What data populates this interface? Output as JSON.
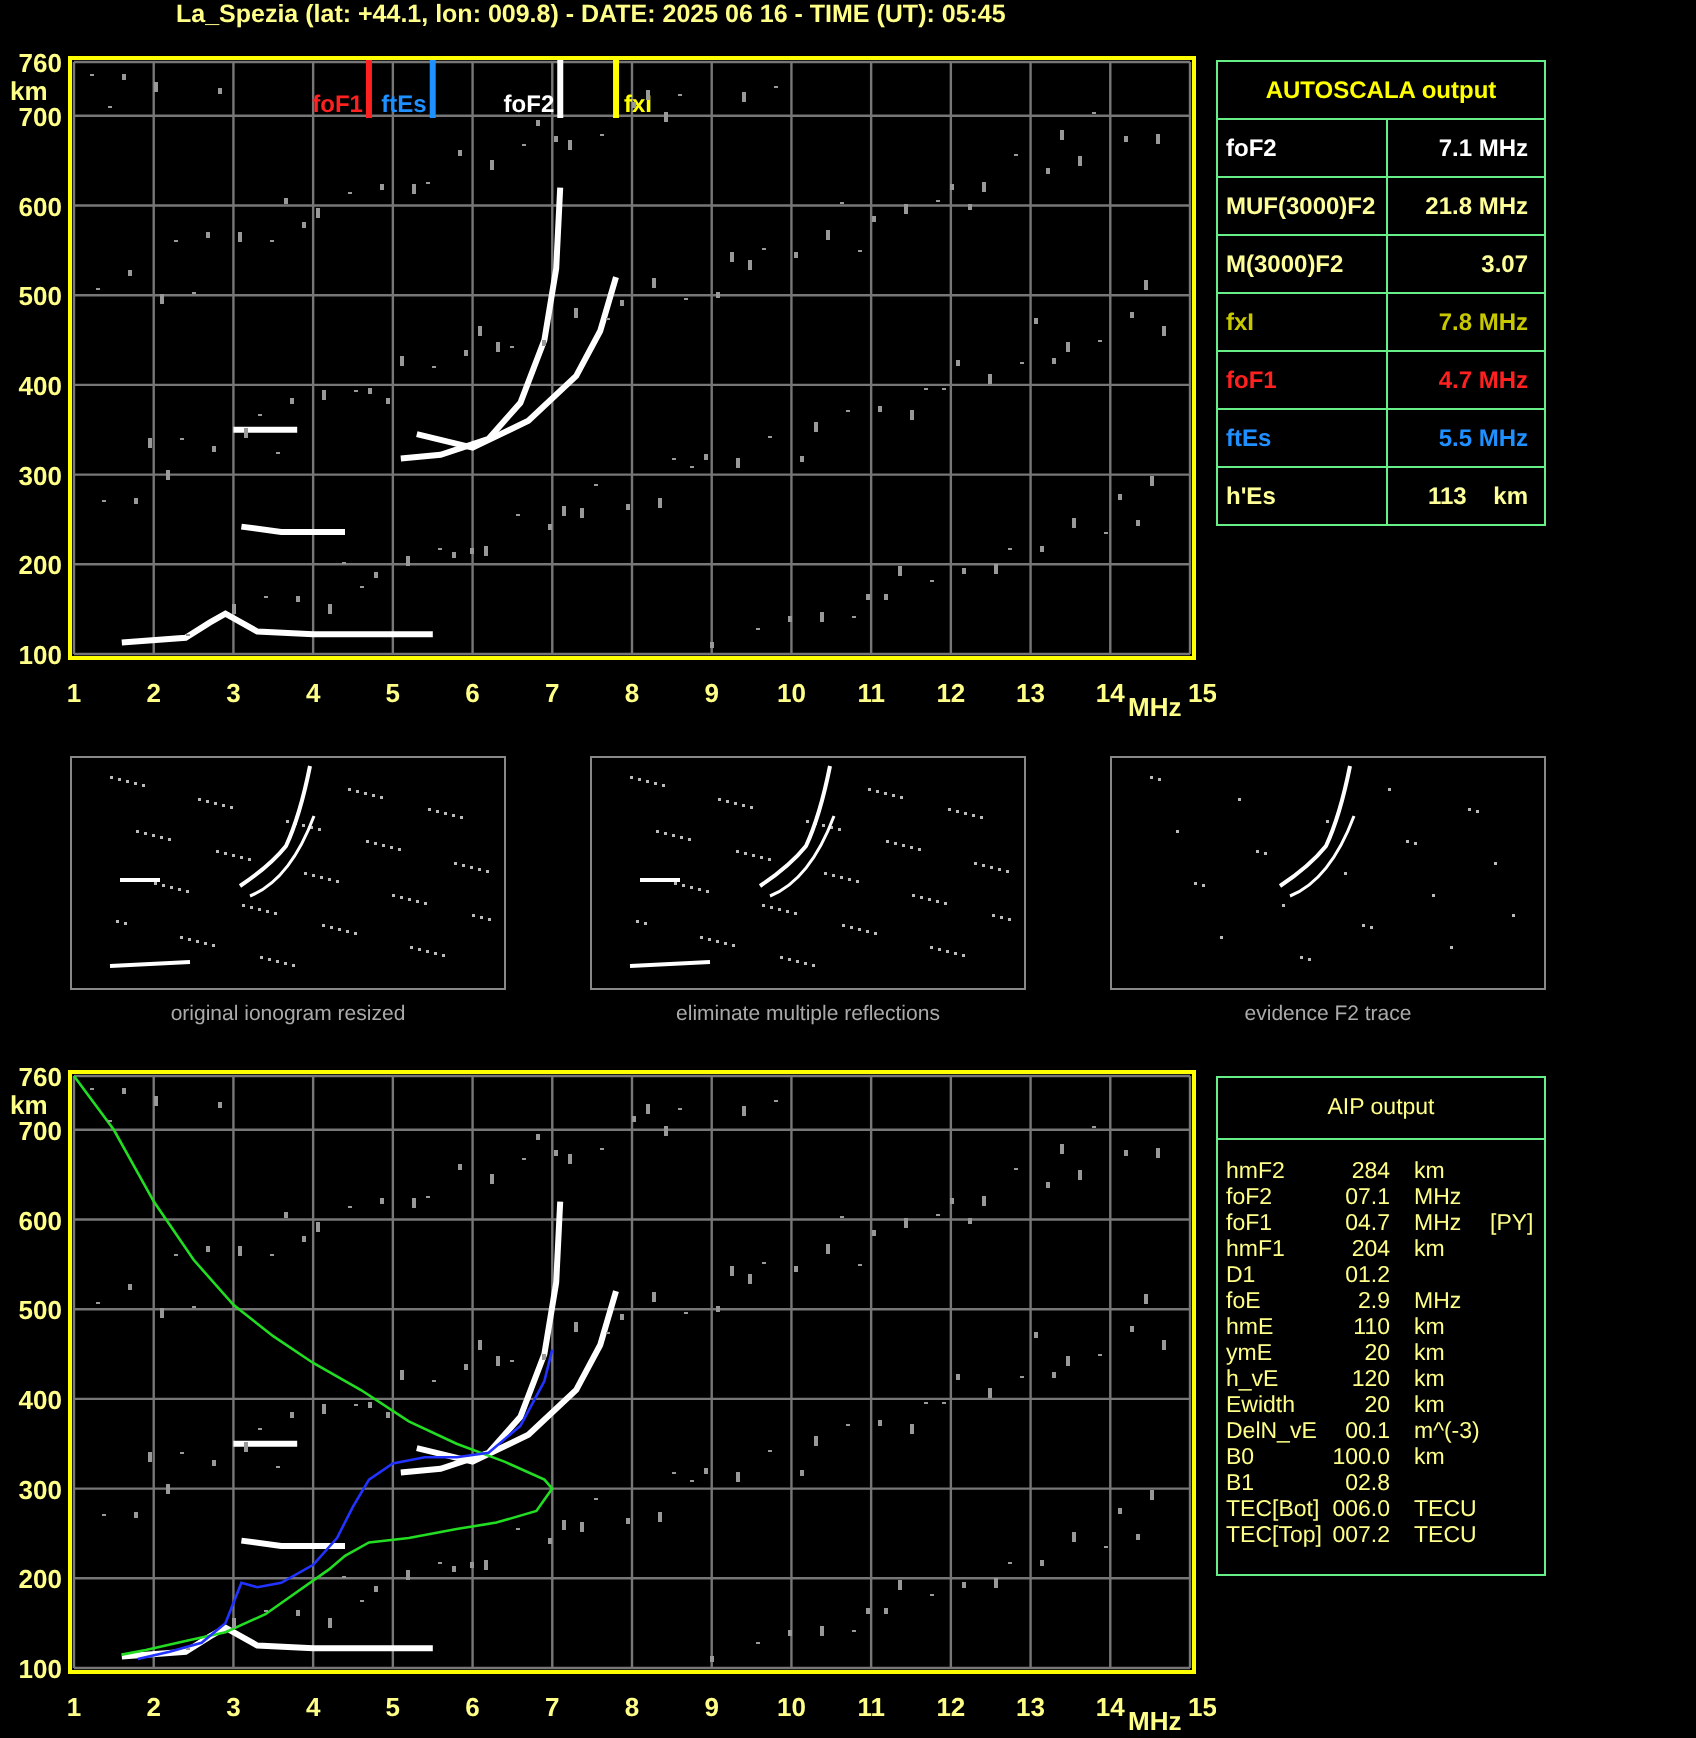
{
  "title": "La_Spezia (lat: +44.1, lon: 009.8) - DATE: 2025 06 16 - TIME (UT): 05:45",
  "top_chart": {
    "chart_data": {
      "type": "line",
      "xlabel": "MHz",
      "ylabel": "km",
      "xlim": [
        1,
        15
      ],
      "ylim": [
        100,
        760
      ],
      "grid": true,
      "xticks": [
        1,
        2,
        3,
        4,
        5,
        6,
        7,
        8,
        9,
        10,
        11,
        12,
        13,
        14,
        15
      ],
      "yticks": [
        100,
        200,
        300,
        400,
        500,
        600,
        700,
        760
      ],
      "series": [
        {
          "color": "#ffffff",
          "x": [
            1.6,
            2.4,
            2.7,
            2.9,
            3.3,
            4.0,
            5.5
          ],
          "values": [
            113,
            118,
            135,
            145,
            125,
            122,
            122
          ]
        },
        {
          "color": "#ffffff",
          "x": [
            3.0,
            3.8
          ],
          "values": [
            350,
            350
          ]
        },
        {
          "color": "#ffffff",
          "x": [
            3.1,
            3.6,
            4.4
          ],
          "values": [
            242,
            236,
            236
          ]
        },
        {
          "color": "#ffffff",
          "x": [
            5.1,
            5.6,
            6.2,
            6.6,
            6.9,
            7.05,
            7.1
          ],
          "values": [
            318,
            322,
            340,
            380,
            450,
            530,
            620
          ]
        },
        {
          "color": "#ffffff",
          "x": [
            5.3,
            6.0,
            6.7,
            7.3,
            7.6,
            7.8
          ],
          "values": [
            345,
            330,
            360,
            410,
            460,
            520
          ]
        }
      ],
      "ref_lines": [
        {
          "axis": "x",
          "value": 4.7,
          "label": "foF1",
          "color": "#ff2020"
        },
        {
          "axis": "x",
          "value": 5.5,
          "label": "ftEs",
          "color": "#1e90ff"
        },
        {
          "axis": "x",
          "value": 7.1,
          "label": "foF2",
          "color": "#ffffff"
        },
        {
          "axis": "x",
          "value": 7.8,
          "label": "fxI",
          "color": "#ffff00"
        }
      ]
    }
  },
  "autoscala": {
    "title": "AUTOSCALA output",
    "rows": [
      {
        "label": "foF2",
        "value": "7.1 MHz",
        "color": "#ffffff"
      },
      {
        "label": "MUF(3000)F2",
        "value": "21.8 MHz",
        "color": "#ffff99"
      },
      {
        "label": "M(3000)F2",
        "value": "3.07",
        "color": "#ffff99"
      },
      {
        "label": "fxI",
        "value": "7.8 MHz",
        "color": "#c8c800"
      },
      {
        "label": "foF1",
        "value": "4.7 MHz",
        "color": "#ff2020"
      },
      {
        "label": "ftEs",
        "value": "5.5 MHz",
        "color": "#1e90ff"
      },
      {
        "label": "h'Es",
        "value": "113    km",
        "color": "#ffff99"
      }
    ]
  },
  "thumbnails": [
    {
      "caption": "original ionogram resized"
    },
    {
      "caption": "eliminate multiple reflections"
    },
    {
      "caption": "evidence F2 trace"
    }
  ],
  "bottom_chart": {
    "chart_data": {
      "type": "line",
      "xlabel": "MHz",
      "ylabel": "km",
      "xlim": [
        1,
        15
      ],
      "ylim": [
        100,
        760
      ],
      "grid": true,
      "xticks": [
        1,
        2,
        3,
        4,
        5,
        6,
        7,
        8,
        9,
        10,
        11,
        12,
        13,
        14,
        15
      ],
      "yticks": [
        100,
        200,
        300,
        400,
        500,
        600,
        700,
        760
      ],
      "series": [
        {
          "color": "#ffffff",
          "x": [
            1.6,
            2.4,
            2.7,
            2.9,
            3.3,
            4.0,
            5.5
          ],
          "values": [
            113,
            118,
            135,
            145,
            125,
            122,
            122
          ]
        },
        {
          "color": "#ffffff",
          "x": [
            3.0,
            3.8
          ],
          "values": [
            350,
            350
          ]
        },
        {
          "color": "#ffffff",
          "x": [
            3.1,
            3.6,
            4.4
          ],
          "values": [
            242,
            236,
            236
          ]
        },
        {
          "color": "#ffffff",
          "x": [
            5.1,
            5.6,
            6.2,
            6.6,
            6.9,
            7.05,
            7.1
          ],
          "values": [
            318,
            322,
            340,
            380,
            450,
            530,
            620
          ]
        },
        {
          "color": "#ffffff",
          "x": [
            5.3,
            6.0,
            6.7,
            7.3,
            7.6,
            7.8
          ],
          "values": [
            345,
            330,
            360,
            410,
            460,
            520
          ]
        },
        {
          "color": "#22dd22",
          "x": [
            1.0,
            1.5,
            2.0,
            2.5,
            3.0,
            3.5,
            4.0,
            4.6,
            5.2,
            5.8,
            6.4,
            6.9,
            7.0,
            6.8,
            6.3,
            5.8,
            5.2,
            4.7,
            4.4,
            4.2,
            3.4,
            2.9,
            2.4,
            1.9,
            1.6
          ],
          "values": [
            760,
            700,
            620,
            555,
            505,
            470,
            440,
            410,
            375,
            350,
            330,
            310,
            300,
            275,
            262,
            255,
            245,
            240,
            225,
            210,
            160,
            140,
            130,
            120,
            115
          ]
        },
        {
          "color": "#2233ff",
          "x": [
            1.8,
            2.2,
            2.6,
            2.9,
            3.1,
            3.3,
            3.6,
            4.0,
            4.3,
            4.5,
            4.7,
            5.0,
            5.4,
            5.8,
            6.2,
            6.6,
            6.9,
            7.0
          ],
          "values": [
            110,
            118,
            128,
            150,
            195,
            190,
            195,
            215,
            245,
            280,
            310,
            328,
            335,
            335,
            340,
            370,
            420,
            455
          ]
        }
      ]
    }
  },
  "aip": {
    "title": "AIP output",
    "rows": [
      {
        "name": "hmF2",
        "value": "284",
        "unit": "km"
      },
      {
        "name": "foF2",
        "value": "07.1",
        "unit": "MHz"
      },
      {
        "name": "foF1",
        "value": "04.7",
        "unit": "MHz",
        "flag": "[PY]"
      },
      {
        "name": "hmF1",
        "value": "204",
        "unit": "km"
      },
      {
        "name": "D1",
        "value": "01.2"
      },
      {
        "name": "foE",
        "value": "2.9",
        "unit": "MHz"
      },
      {
        "name": "hmE",
        "value": "110",
        "unit": "km"
      },
      {
        "name": "ymE",
        "value": "20",
        "unit": "km"
      },
      {
        "name": "h_vE",
        "value": "120",
        "unit": "km"
      },
      {
        "name": "Ewidth",
        "value": "20",
        "unit": "km"
      },
      {
        "name": "DelN_vE",
        "value": "00.1",
        "unit": "m^(-3)"
      },
      {
        "name": "B0",
        "value": "100.0",
        "unit": "km"
      },
      {
        "name": "B1",
        "value": "02.8"
      },
      {
        "name": "TEC[Bot]",
        "value": "006.0",
        "unit": "TECU"
      },
      {
        "name": "TEC[Top]",
        "value": "007.2",
        "unit": "TECU"
      }
    ]
  }
}
